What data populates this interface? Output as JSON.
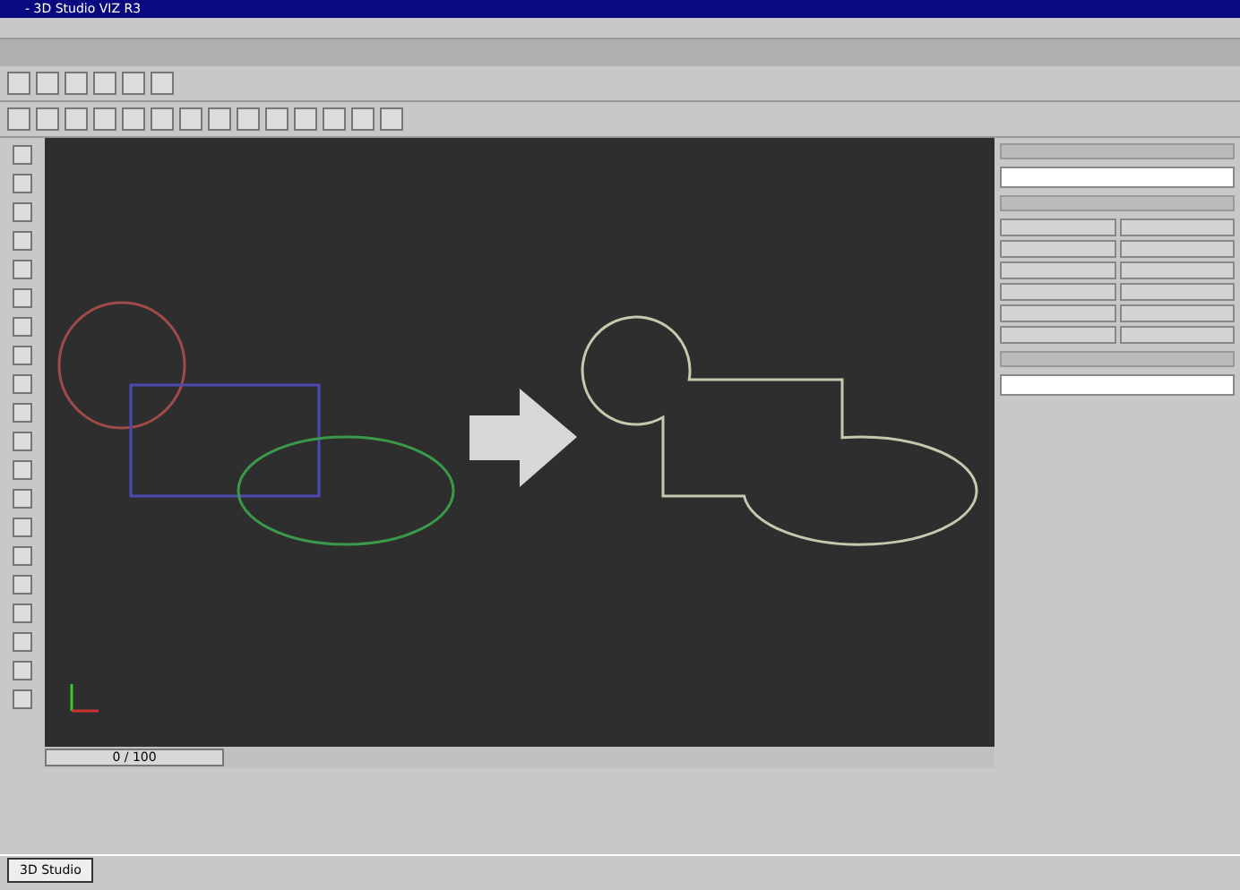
{
  "window": {
    "title": "- 3D Studio VIZ R3"
  },
  "viewport": {
    "shapes": [
      {
        "kind": "circle",
        "color": "#a04a4a"
      },
      {
        "kind": "rect",
        "color": "#4a4ab0"
      },
      {
        "kind": "ellipse",
        "color": "#3a9a4a"
      },
      {
        "kind": "arrow",
        "color": "#d8d8d8"
      },
      {
        "kind": "union",
        "color": "#c8c8b0"
      }
    ]
  },
  "time_slider": {
    "label": "0 / 100"
  },
  "taskbar": {
    "items": [
      {
        "label": "3D Studio",
        "selected": true
      }
    ]
  }
}
